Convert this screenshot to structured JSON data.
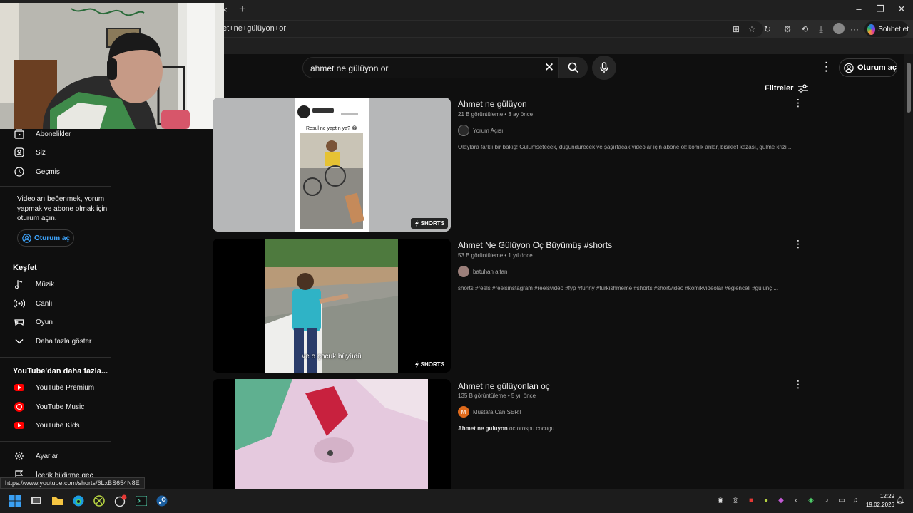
{
  "browser": {
    "url_fragment": "et+ne+gülüyon+or",
    "copilot_label": "Sohbet et",
    "tab_close": "×",
    "tab_new": "+"
  },
  "header": {
    "search_value": "ahmet ne gülüyon or",
    "signin_label": "Oturum aç",
    "filters_label": "Filtreler"
  },
  "sidebar": {
    "items_top": [
      {
        "label": "Abonelikler",
        "icon": "subscriptions-icon"
      },
      {
        "label": "Siz",
        "icon": "you-icon"
      },
      {
        "label": "Geçmiş",
        "icon": "history-icon"
      }
    ],
    "signin_note": "Videoları beğenmek, yorum yapmak ve abone olmak için oturum açın.",
    "signin_label": "Oturum aç",
    "explore_heading": "Keşfet",
    "explore_items": [
      {
        "label": "Müzik",
        "icon": "music-icon"
      },
      {
        "label": "Canlı",
        "icon": "live-icon"
      },
      {
        "label": "Oyun",
        "icon": "gaming-icon"
      },
      {
        "label": "Daha fazla göster",
        "icon": "chevron-down-icon"
      }
    ],
    "more_heading": "YouTube'dan daha fazla...",
    "more_items": [
      {
        "label": "YouTube Premium",
        "icon": "youtube-premium-icon"
      },
      {
        "label": "YouTube Music",
        "icon": "youtube-music-icon"
      },
      {
        "label": "YouTube Kids",
        "icon": "youtube-kids-icon"
      }
    ],
    "bottom_items": [
      {
        "label": "Ayarlar",
        "icon": "settings-icon"
      },
      {
        "label": "İçerik bildirme geç",
        "icon": "flag-icon"
      }
    ]
  },
  "results": [
    {
      "title": "Ahmet ne gülüyon",
      "meta": "21 B görüntüleme • 3 ay önce",
      "channel": "Yorum Açısı",
      "description": "Olaylara farklı bir bakış! Gülümsetecek, düşündürecek ve şaşırtacak videolar için abone ol! komik anlar, bisiklet kazası, gülme krizi ...",
      "badge": "SHORTS",
      "thumb_caption": "Resul ne yaptın ya? 😂"
    },
    {
      "title": "Ahmet Ne Gülüyon Oç Büyümüş #shorts",
      "meta": "53 B görüntüleme • 1 yıl önce",
      "channel": "batuhan altan",
      "description": "shorts #reels #reelsinstagram #reelsvideo #fyp #funny #turkishmeme #shorts #shortvideo #komikvideolar #eğlenceli #gülünç ...",
      "badge": "SHORTS",
      "thumb_caption": "ve o çocuk büyüdü"
    },
    {
      "title": "Ahmet ne gülüyonlan oç",
      "meta": "135 B görüntüleme • 5 yıl önce",
      "channel": "Mustafa Can SERT",
      "channel_initial": "M",
      "description_bold": "Ahmet ne guluyon",
      "description_rest": " oc orospu cocugu."
    }
  ],
  "status_url": "https://www.youtube.com/shorts/6LxBS654N8E",
  "taskbar": {
    "time": "12:29",
    "date": "19.02.2026"
  },
  "colors": {
    "background": "#0f0f0f",
    "accent_blue": "#3ea6ff",
    "youtube_red": "#ff0000"
  }
}
